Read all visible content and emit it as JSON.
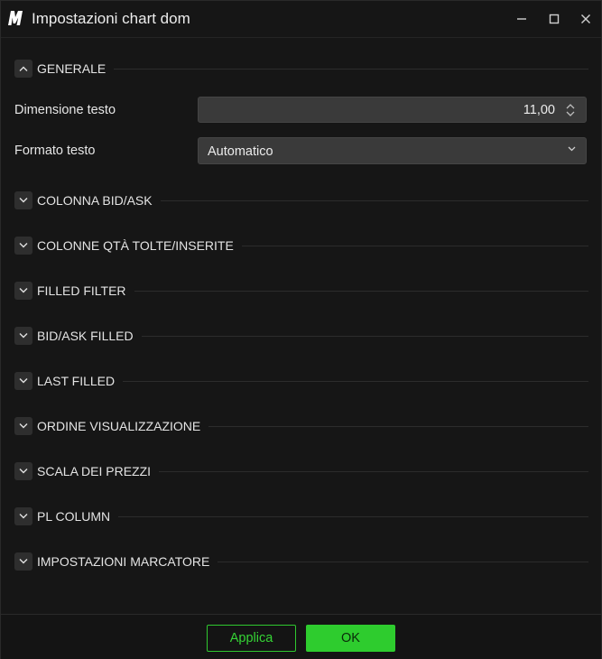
{
  "window": {
    "title": "Impostazioni chart dom",
    "logo_icon": "m-logo-icon",
    "controls": [
      "minimize-icon",
      "maximize-icon",
      "close-icon"
    ]
  },
  "sections": [
    {
      "label": "GENERALE",
      "expanded": true
    },
    {
      "label": "COLONNA BID/ASK",
      "expanded": false
    },
    {
      "label": "COLONNE QTÀ TOLTE/INSERITE",
      "expanded": false
    },
    {
      "label": "FILLED FILTER",
      "expanded": false
    },
    {
      "label": "BID/ASK FILLED",
      "expanded": false
    },
    {
      "label": "LAST FILLED",
      "expanded": false
    },
    {
      "label": "ORDINE VISUALIZZAZIONE",
      "expanded": false
    },
    {
      "label": "SCALA DEI PREZZI",
      "expanded": false
    },
    {
      "label": "PL COLUMN",
      "expanded": false
    },
    {
      "label": "IMPOSTAZIONI MARCATORE",
      "expanded": false
    }
  ],
  "general": {
    "text_size_label": "Dimensione testo",
    "text_size_value": "11,00",
    "text_format_label": "Formato testo",
    "text_format_value": "Automatico"
  },
  "footer": {
    "apply_label": "Applica",
    "ok_label": "OK"
  },
  "colors": {
    "accent": "#2ecc2e",
    "background": "#161616",
    "input_bg": "#3a3a3a"
  }
}
